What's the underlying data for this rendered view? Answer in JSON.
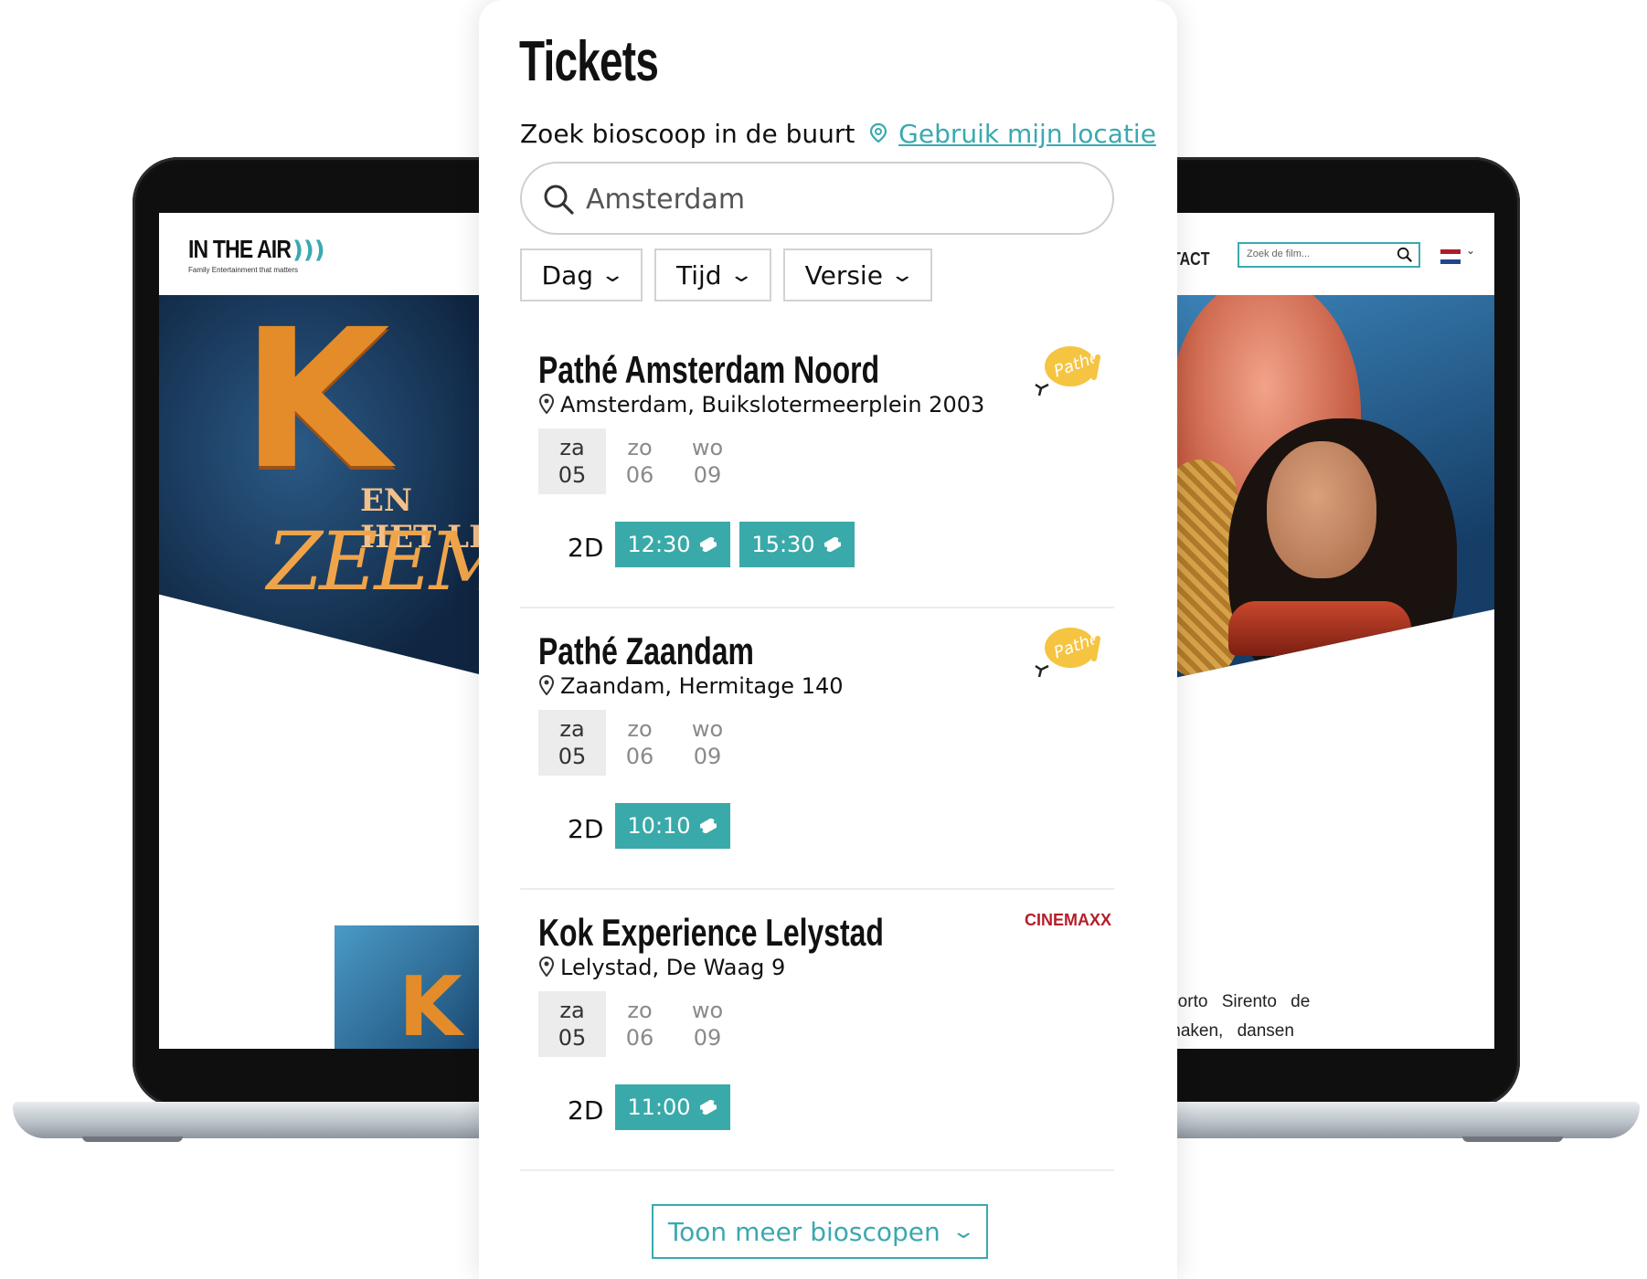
{
  "laptop_site": {
    "logo_title": "IN THE AIR",
    "logo_tagline": "Family Entertainment that matters",
    "nav_contact": "TACT",
    "search_placeholder": "Zoek de film...",
    "hero_letter": "K",
    "hero_subtitle_1": "EN HET LI",
    "hero_subtitle_2": "ZEEME",
    "thumb_letter": "K",
    "body_text_line1": "Porto Sirento de",
    "body_text_line2": "maken, dansen"
  },
  "ticket_panel": {
    "title": "Tickets",
    "locate_prompt": "Zoek bioscoop in de buurt",
    "locate_link": "Gebruik mijn locatie",
    "search": {
      "value": "Amsterdam"
    },
    "filters": [
      "Dag",
      "Tijd",
      "Versie"
    ],
    "cinemas": [
      {
        "name": "Pathé Amsterdam Noord",
        "address": "Amsterdam, Buikslotermeerplein 2003",
        "logo": "pathe-logo",
        "dates": [
          {
            "day": "za",
            "num": "05",
            "active": true
          },
          {
            "day": "zo",
            "num": "06",
            "active": false
          },
          {
            "day": "wo",
            "num": "09",
            "active": false
          }
        ],
        "version": "2D",
        "times": [
          "12:30",
          "15:30"
        ]
      },
      {
        "name": "Pathé Zaandam",
        "address": "Zaandam, Hermitage 140",
        "logo": "pathe-logo",
        "dates": [
          {
            "day": "za",
            "num": "05",
            "active": true
          },
          {
            "day": "zo",
            "num": "06",
            "active": false
          },
          {
            "day": "wo",
            "num": "09",
            "active": false
          }
        ],
        "version": "2D",
        "times": [
          "10:10"
        ]
      },
      {
        "name": "Kok Experience Lelystad",
        "address": "Lelystad, De Waag 9",
        "logo": "kok-cinemaxx-logo",
        "logo_text": "CINEMAXX",
        "dates": [
          {
            "day": "za",
            "num": "05",
            "active": true
          },
          {
            "day": "zo",
            "num": "06",
            "active": false
          },
          {
            "day": "wo",
            "num": "09",
            "active": false
          }
        ],
        "version": "2D",
        "times": [
          "11:00"
        ]
      }
    ],
    "more_button": "Toon meer bioscopen"
  },
  "colors": {
    "accent": "#3aa9a9",
    "link": "#3aa9b0",
    "date_active_bg": "#ececec",
    "kok_red": "#b41e2a",
    "pathe_yellow": "#f5c441"
  }
}
